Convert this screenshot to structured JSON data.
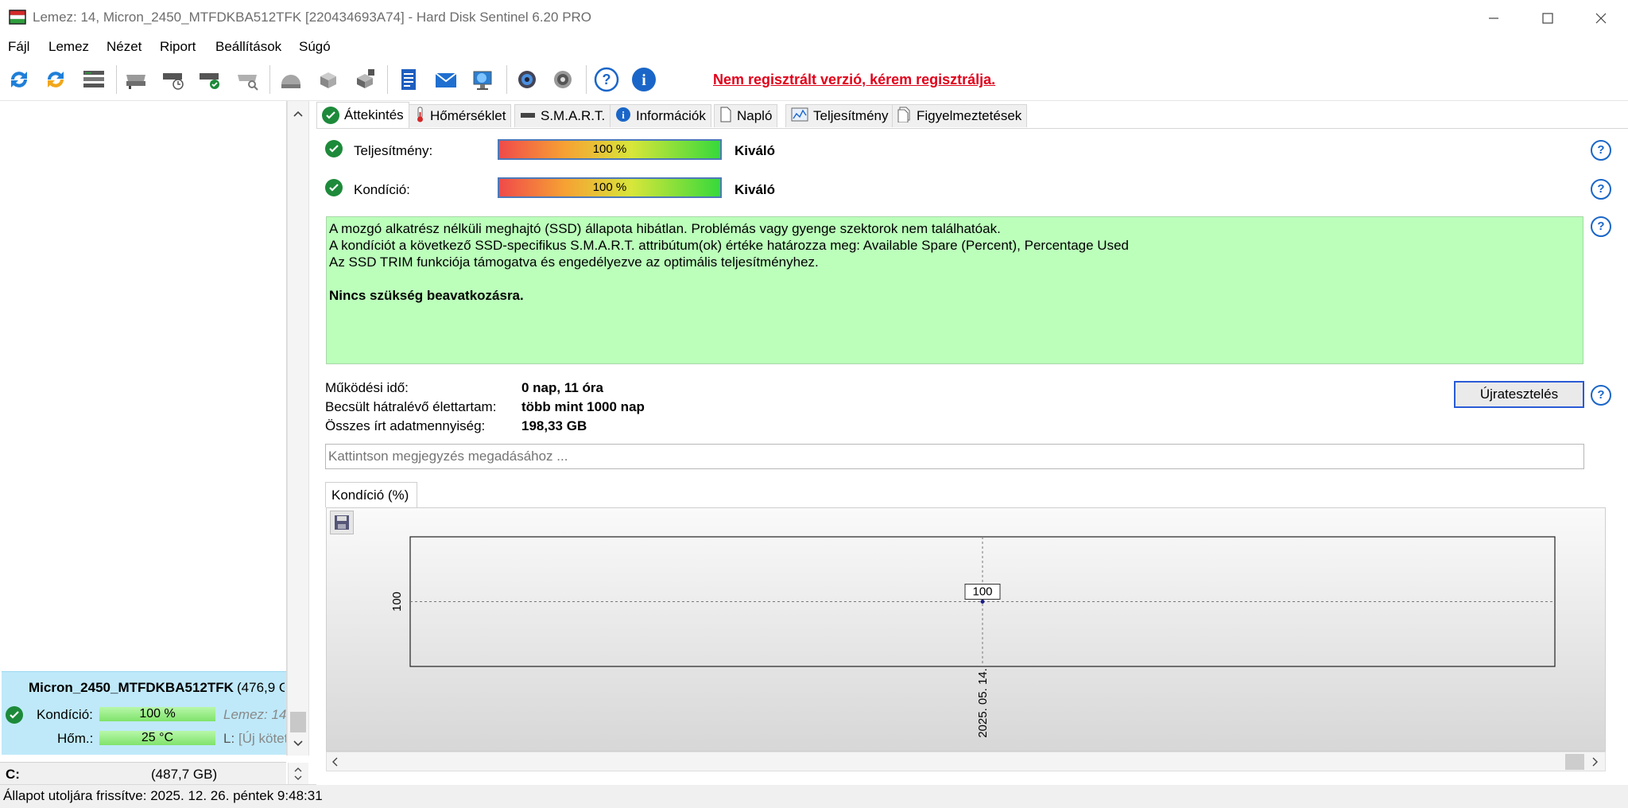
{
  "window": {
    "title": "Lemez: 14, Micron_2450_MTFDKBA512TFK [220434693A74]  -  Hard Disk Sentinel 6.20 PRO"
  },
  "menu": [
    {
      "label": "Fájl"
    },
    {
      "label": "Lemez"
    },
    {
      "label": "Nézet"
    },
    {
      "label": "Riport"
    },
    {
      "label": "Beállítások"
    },
    {
      "label": "Súgó"
    }
  ],
  "toolbar": {
    "icons": [
      "refresh-icon",
      "refresh-all-icon",
      "disk-list-icon",
      "disk-icon",
      "disk-schedule-icon",
      "disk-check-icon",
      "disk-search-icon",
      "surface-test-icon",
      "cube-disk-icon",
      "network-disk-icon",
      "log-icon",
      "email-icon",
      "monitor-globe-icon",
      "settings-gear-icon",
      "sound-icon",
      "help-icon",
      "info-icon"
    ],
    "registration_warning": "Nem regisztrált verzió, kérem regisztrálja."
  },
  "tabs": [
    {
      "label": "Áttekintés",
      "icon": "check-icon"
    },
    {
      "label": "Hőmérséklet",
      "icon": "thermometer-icon"
    },
    {
      "label": "S.M.A.R.T.",
      "icon": "smart-drive-icon"
    },
    {
      "label": "Információk",
      "icon": "info-icon"
    },
    {
      "label": "Napló",
      "icon": "document-icon"
    },
    {
      "label": "Teljesítmény",
      "icon": "chart-icon"
    },
    {
      "label": "Figyelmeztetések",
      "icon": "alerts-icon"
    }
  ],
  "overview": {
    "performance": {
      "label": "Teljesítmény:",
      "percent": 100,
      "bar_text": "100 %",
      "rating": "Kiváló"
    },
    "health": {
      "label": "Kondíció:",
      "percent": 100,
      "bar_text": "100 %",
      "rating": "Kiváló"
    },
    "status_lines": [
      "A mozgó alkatrész nélküli meghajtó (SSD) állapota hibátlan. Problémás vagy gyenge szektorok nem találhatóak.",
      "A kondíciót a következő SSD-specifikus S.M.A.R.T. attribútum(ok) értéke határozza meg:  Available Spare (Percent), Percentage Used",
      "Az SSD TRIM funkciója támogatva és engedélyezve az optimális teljesítményhez."
    ],
    "status_bold": "Nincs szükség beavatkozásra.",
    "stats": {
      "power_on_label": "Működési idő:",
      "power_on_value": "0 nap, 11 óra",
      "remaining_label": "Becsült hátralévő élettartam:",
      "remaining_value": "több mint 1000 nap",
      "written_label": "Összes írt adatmennyiség:",
      "written_value": "198,33 GB"
    },
    "retest_button": "Újratesztelés",
    "comment_placeholder": "Kattintson megjegyzés megadásához ...",
    "chart_tab": "Kondíció  (%)"
  },
  "chart_data": {
    "type": "line",
    "title": "Kondíció  (%)",
    "x": [
      "2025. 05. 14."
    ],
    "values": [
      100
    ],
    "point_label": "100",
    "y_tick_labels": [
      "100"
    ],
    "x_tick_labels": [
      "2025. 05. 14."
    ],
    "grid": true
  },
  "disk_panel": {
    "name": "Micron_2450_MTFDKBA512TFK",
    "size": "(476,9 G",
    "health_label": "Kondíció:",
    "health_value": "100 %",
    "health_percent": 100,
    "disk_index": "Lemez: 14",
    "temp_label": "Hőm.:",
    "temp_value": "25 °C",
    "volume_label": "L:",
    "volume_value": "[Új kötet"
  },
  "drive": {
    "letter": "C:",
    "size": "(487,7 GB)"
  },
  "statusbar": {
    "text": "Állapot utoljára frissítve: 2025. 12. 26. péntek 9:48:31"
  },
  "colors": {
    "status_good_bg": "#bbffbb",
    "warning_red": "#e0001a",
    "disk_selected_bg": "#bfe9f9",
    "accent_blue": "#1a66c8"
  }
}
